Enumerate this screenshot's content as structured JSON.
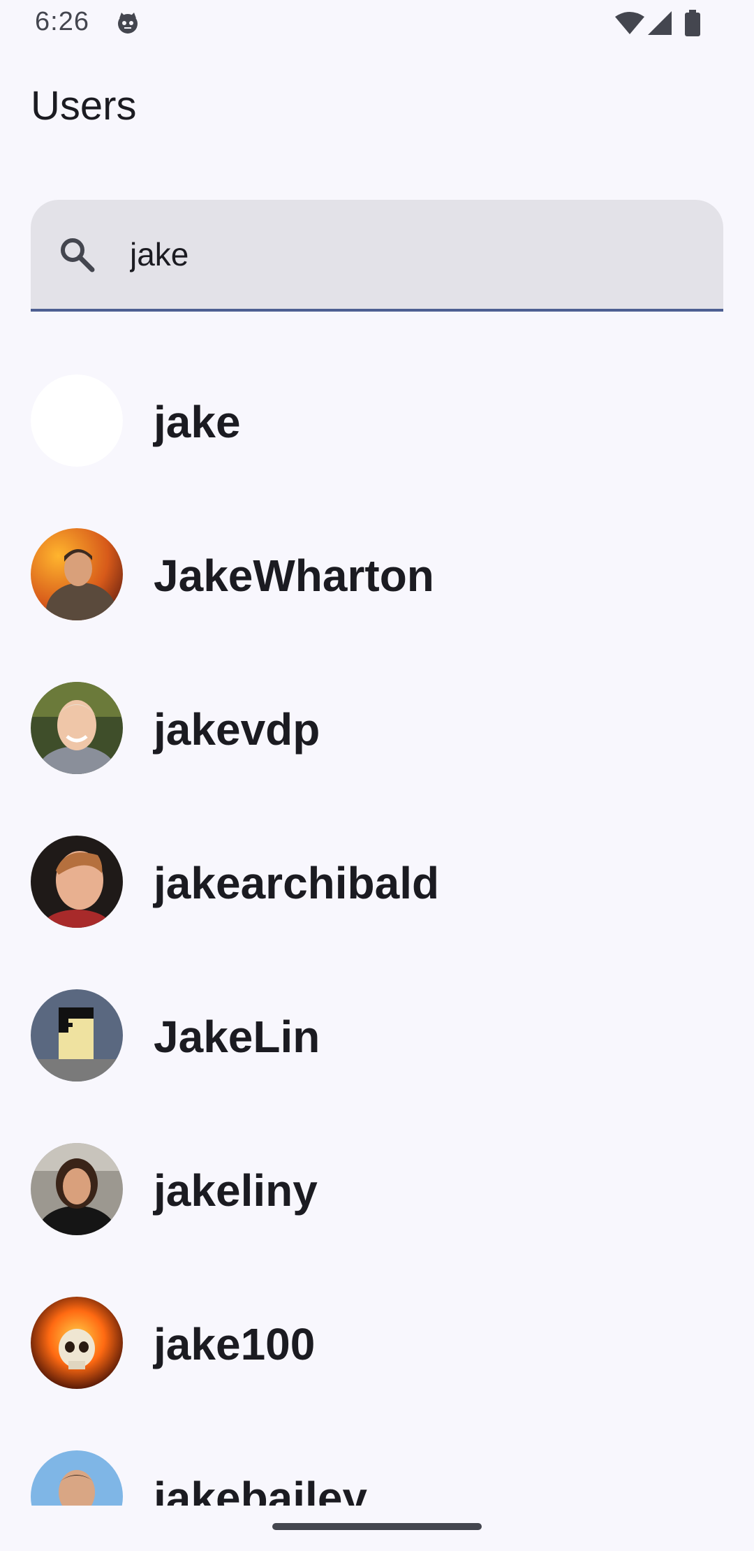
{
  "status_bar": {
    "time": "6:26",
    "app_icon": "android-cat-icon",
    "wifi_icon": "wifi-icon",
    "signal_icon": "cell-signal-icon",
    "battery_icon": "battery-icon"
  },
  "header": {
    "title": "Users"
  },
  "search": {
    "icon": "search-icon",
    "value": "jake",
    "accent_color": "#4e5f92"
  },
  "users": [
    {
      "username": "jake",
      "avatar": "blank-avatar"
    },
    {
      "username": "JakeWharton",
      "avatar": "photo-avatar"
    },
    {
      "username": "jakevdp",
      "avatar": "photo-avatar"
    },
    {
      "username": "jakearchibald",
      "avatar": "photo-avatar"
    },
    {
      "username": "JakeLin",
      "avatar": "pixel-art-avatar"
    },
    {
      "username": "jakeliny",
      "avatar": "photo-avatar"
    },
    {
      "username": "jake100",
      "avatar": "flaming-skull-avatar"
    },
    {
      "username": "jakebailey",
      "avatar": "photo-avatar"
    }
  ]
}
